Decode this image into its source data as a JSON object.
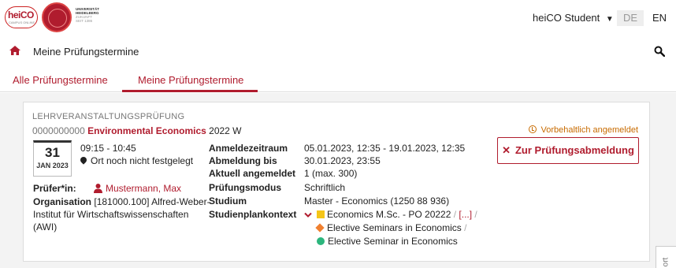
{
  "header": {
    "logo_text": "heiCO",
    "logo_sub": "CAMPUS ONLINE",
    "university_lines": [
      "UNIVERSITÄT",
      "HEIDELBERG",
      "ZUKUNFT",
      "SEIT 1386"
    ],
    "user_menu": "heiCO Student",
    "lang_de": "DE",
    "lang_en": "EN"
  },
  "breadcrumb": {
    "page_title": "Meine Prüfungstermine"
  },
  "tabs": [
    {
      "label": "Alle Prüfungstermine",
      "active": false
    },
    {
      "label": "Meine Prüfungstermine",
      "active": true
    }
  ],
  "exam": {
    "kind": "LEHRVERANSTALTUNGSPRÜFUNG",
    "number": "0000000000",
    "course": "Environmental Economics",
    "semester": "2022 W",
    "status": "Vorbehaltlich angemeldet",
    "deregister_button": "Zur Prüfungsabmeldung",
    "date_day": "31",
    "date_month": "JAN 2023",
    "time": "09:15 - 10:45",
    "location": "Ort noch nicht festgelegt",
    "examiner_label": "Prüfer*in:",
    "examiner_name": "Mustermann, Max",
    "organisation_label": "Organisation",
    "organisation_value": "[181000.100] Alfred-Weber-Institut für Wirtschaftswissenschaften (AWI)",
    "details": [
      {
        "key": "Anmeldezeitraum",
        "value": "05.01.2023, 12:35 - 19.01.2023, 12:35"
      },
      {
        "key": "Abmeldung bis",
        "value": "30.01.2023, 23:55"
      },
      {
        "key": "Aktuell angemeldet",
        "value": "1 (max. 300)"
      },
      {
        "key": "Prüfungsmodus",
        "value": "Schriftlich"
      },
      {
        "key": "Studium",
        "value": "Master - Economics (1250 88 936)"
      },
      {
        "key": "Studienplankontext",
        "value": ""
      }
    ],
    "study_plan": {
      "level1": "Economics M.Sc. - PO 20222",
      "more": "[...]",
      "level2": "Elective Seminars in Economics",
      "level3": "Elective Seminar in Economics"
    }
  },
  "side_tab": "ort",
  "colors": {
    "accent": "#b01c2e",
    "status": "#c86b00"
  }
}
